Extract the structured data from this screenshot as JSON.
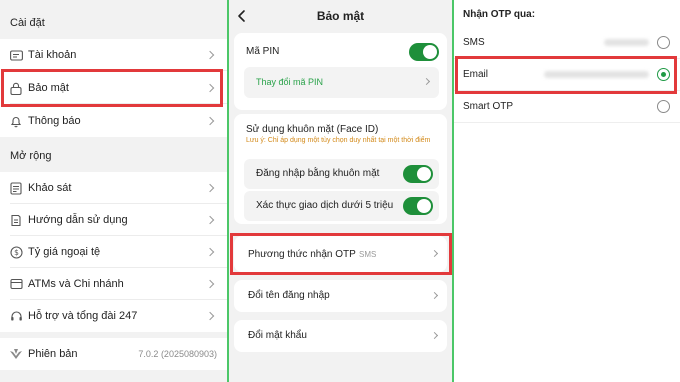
{
  "settings": {
    "section_title": "Cài đặt",
    "items": [
      {
        "label": "Tài khoản",
        "icon": "id-card-icon"
      },
      {
        "label": "Bảo mật",
        "icon": "lock-icon"
      },
      {
        "label": "Thông báo",
        "icon": "bell-icon"
      }
    ]
  },
  "expand": {
    "section_title": "Mở rộng",
    "items": [
      {
        "label": "Khảo sát",
        "icon": "survey-icon"
      },
      {
        "label": "Hướng dẫn sử dụng",
        "icon": "guide-icon"
      },
      {
        "label": "Tỷ giá ngoại tệ",
        "icon": "currency-icon"
      },
      {
        "label": "ATMs và Chi nhánh",
        "icon": "atm-icon"
      },
      {
        "label": "Hỗ trợ và tổng đài 247",
        "icon": "headset-icon"
      }
    ]
  },
  "version": {
    "label": "Phiên bản",
    "value": "7.0.2 (2025080903)",
    "icon": "brand-logo-icon"
  },
  "security": {
    "title": "Bảo mật",
    "pin_label": "Mã PIN",
    "pin_enabled": true,
    "change_pin": "Thay đổi mã PIN",
    "face_id_label": "Sử dụng khuôn mặt (Face ID)",
    "face_id_note": "Lưu ý: Chỉ áp dụng một tùy chọn duy nhất tại một thời điểm",
    "face_login": "Đăng nhập bằng khuôn mặt",
    "face_login_enabled": true,
    "face_tx": "Xác thực giao dịch dưới 5 triệu",
    "face_tx_enabled": true,
    "otp_method_label": "Phương thức nhận OTP",
    "otp_method_value": "SMS",
    "rename_login": "Đổi tên đăng nhập",
    "change_password": "Đổi mật khẩu"
  },
  "otp": {
    "title": "Nhận OTP qua:",
    "options": [
      {
        "label": "SMS",
        "selected": false
      },
      {
        "label": "Email",
        "selected": true
      },
      {
        "label": "Smart OTP",
        "selected": false
      }
    ]
  },
  "colors": {
    "accent_green": "#1e8f3a",
    "highlight_red": "#e2393b",
    "warning_orange": "#d38a1a"
  }
}
